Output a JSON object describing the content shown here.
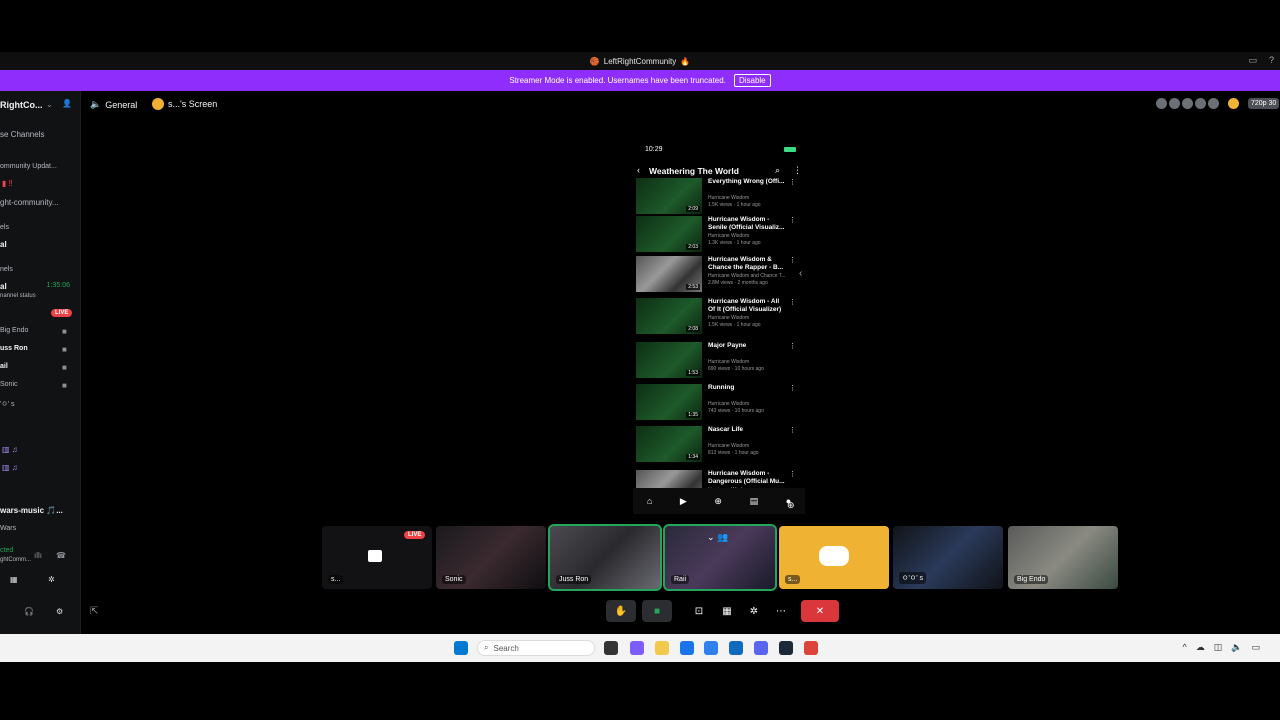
{
  "window": {
    "title": "LeftRightCommunity",
    "title_emoji": "🏀 · 🔥"
  },
  "streamer_banner": {
    "text": "Streamer Mode is enabled. Usernames have been truncated.",
    "button_label": "Disable"
  },
  "sidebar": {
    "server_name": "RightCo...",
    "items": [
      {
        "label": "se Channels",
        "bold": false
      },
      {
        "label": "ommunity Updat...",
        "bold": false
      },
      {
        "label": "ght-community...",
        "bold": false
      },
      {
        "label": "els",
        "bold": false
      },
      {
        "label": "al",
        "bold": true
      },
      {
        "label": "nels",
        "bold": false
      },
      {
        "label": "al",
        "bold": true
      },
      {
        "label": "nannel status",
        "bold": false
      },
      {
        "label": "Big Endo",
        "bold": false
      },
      {
        "label": "uss Ron",
        "bold": true
      },
      {
        "label": "ail",
        "bold": true
      },
      {
        "label": "Sonic",
        "bold": false
      },
      {
        "label": "'ㅇ' s",
        "bold": false
      },
      {
        "label": "wars-music 🎵...",
        "bold": true
      },
      {
        "label": "Wars",
        "bold": false
      },
      {
        "label": "cted",
        "bold": false
      },
      {
        "label": "ghtComm...",
        "bold": false
      }
    ],
    "voice_timer": "1:35:06",
    "live_label": "LIVE"
  },
  "header": {
    "channel": "General",
    "screen_label": "s...'s Screen",
    "quality": "720p 30"
  },
  "phone": {
    "time": "10:29",
    "title": "Weathering The World",
    "videos": [
      {
        "title": "Everything Wrong (Offi...",
        "channel": "Hurricane Wisdom",
        "meta": "1.5K views · 1 hour ago",
        "duration": "2:09",
        "style": "green"
      },
      {
        "title": "Hurricane Wisdom - Senile (Official Visualiz...",
        "channel": "Hurricane Wisdom",
        "meta": "1.3K views · 1 hour ago",
        "duration": "2:03",
        "style": "green"
      },
      {
        "title": "Hurricane Wisdom & Chance the Rapper - B...",
        "channel": "Hurricane Wisdom and Chance T...",
        "meta": "2.8M views · 2 months ago",
        "duration": "2:53",
        "style": "photo"
      },
      {
        "title": "Hurricane Wisdom - All Of It (Official Visualizer)",
        "channel": "Hurricane Wisdom",
        "meta": "1.5K views · 1 hour ago",
        "duration": "2:08",
        "style": "green"
      },
      {
        "title": "Major Payne",
        "channel": "Hurricane Wisdom",
        "meta": "690 views · 10 hours ago",
        "duration": "1:53",
        "style": "green"
      },
      {
        "title": "Running",
        "channel": "Hurricane Wisdom",
        "meta": "743 views · 10 hours ago",
        "duration": "1:35",
        "style": "green"
      },
      {
        "title": "Nascar Life",
        "channel": "Hurricane Wisdom",
        "meta": "813 views · 1 hour ago",
        "duration": "1:34",
        "style": "green"
      },
      {
        "title": "Hurricane Wisdom - Dangerous (Official Mu...",
        "channel": "Hurricane Wisdom",
        "meta": "",
        "duration": "",
        "style": "photo"
      }
    ],
    "nav": [
      "Home",
      "Shorts",
      "+",
      "Subscriptions",
      "You"
    ]
  },
  "tiles": [
    {
      "name": "s...",
      "type": "screen",
      "live": "LIVE"
    },
    {
      "name": "Sonic",
      "type": "video"
    },
    {
      "name": "Juss Ron",
      "type": "video",
      "speaking": true
    },
    {
      "name": "Raii",
      "type": "video",
      "speaking": true
    },
    {
      "name": "s...",
      "type": "discord"
    },
    {
      "name": "ㅇ'ㅇ' s",
      "type": "video"
    },
    {
      "name": "Big Endo",
      "type": "video"
    }
  ],
  "taskbar": {
    "search_placeholder": "Search"
  },
  "colors": {
    "streamer_banner": "#8f2dfc",
    "live_red": "#ed4245",
    "speaking_green": "#23a55a",
    "discord_yellow": "#f0b232",
    "end_call": "#da373c"
  }
}
